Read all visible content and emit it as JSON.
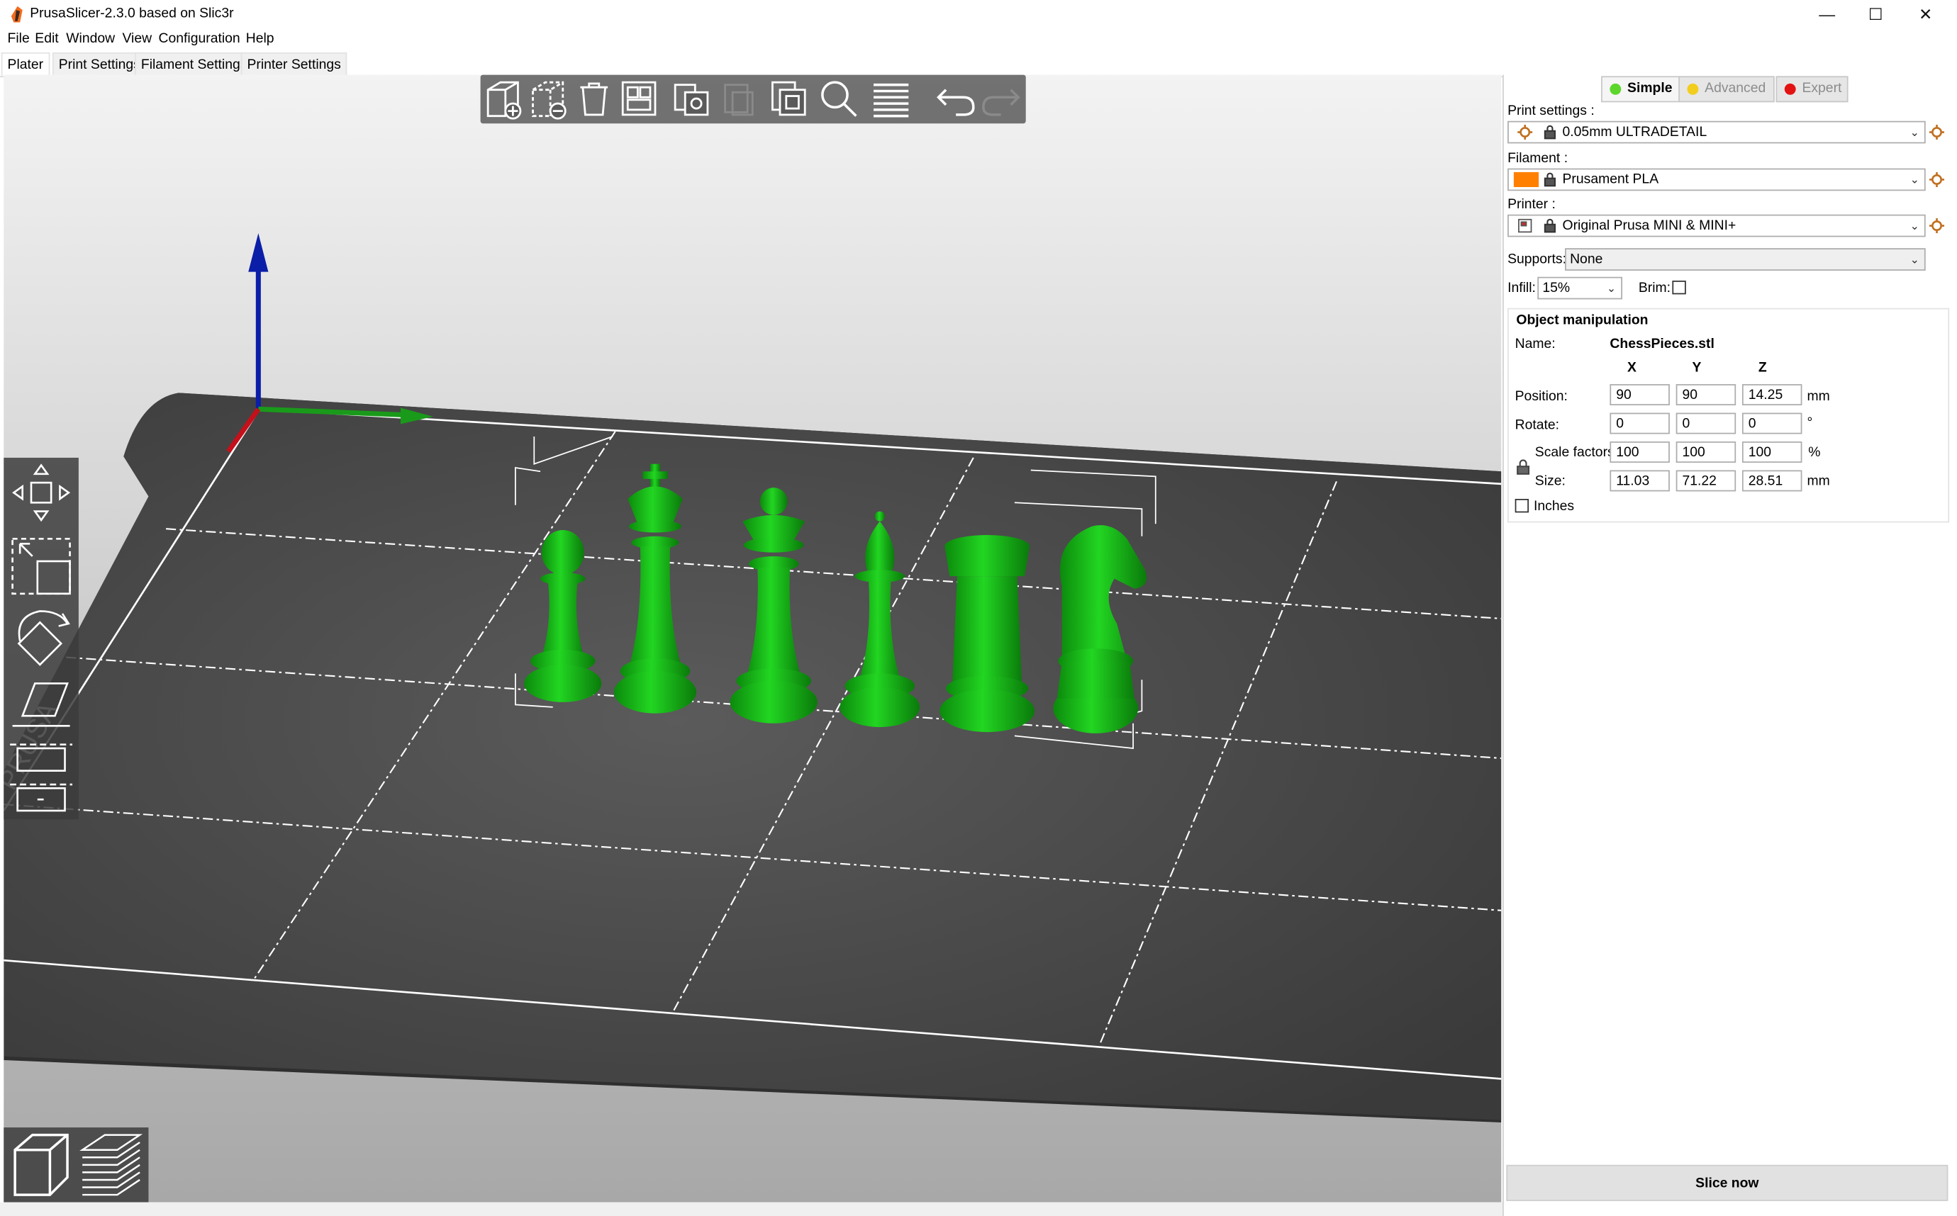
{
  "window": {
    "title": "PrusaSlicer-2.3.0 based on Slic3r",
    "minimize": "—",
    "maximize": "☐",
    "close": "✕"
  },
  "menu": [
    "File",
    "Edit",
    "Window",
    "View",
    "Configuration",
    "Help"
  ],
  "tabs": [
    "Plater",
    "Print Settings",
    "Filament Settings",
    "Printer Settings"
  ],
  "modes": [
    {
      "label": "Simple",
      "color": "#5cd62b"
    },
    {
      "label": "Advanced",
      "color": "#f2cd1e"
    },
    {
      "label": "Expert",
      "color": "#e31313"
    }
  ],
  "presets": {
    "print_label": "Print settings :",
    "print_value": "0.05mm ULTRADETAIL",
    "filament_label": "Filament :",
    "filament_value": "Prusament PLA",
    "filament_color": "#ff8000",
    "printer_label": "Printer :",
    "printer_value": "Original Prusa MINI & MINI+",
    "supports_label": "Supports:",
    "supports_value": "None",
    "infill_label": "Infill:",
    "infill_value": "15%",
    "brim_label": "Brim:"
  },
  "object": {
    "heading": "Object manipulation",
    "name_label": "Name:",
    "name_value": "ChessPieces.stl",
    "axes": [
      "X",
      "Y",
      "Z"
    ],
    "position_label": "Position:",
    "position": [
      "90",
      "90",
      "14.25"
    ],
    "position_unit": "mm",
    "rotate_label": "Rotate:",
    "rotate": [
      "0",
      "0",
      "0"
    ],
    "rotate_unit": "°",
    "scale_label": "Scale factors:",
    "scale": [
      "100",
      "100",
      "100"
    ],
    "scale_unit": "%",
    "size_label": "Size:",
    "size": [
      "11.03",
      "71.22",
      "28.51"
    ],
    "size_unit": "mm",
    "inches_label": "Inches"
  },
  "slice_button": "Slice now",
  "accent": {
    "pieces": "#16c416",
    "axis_z": "#0b1ea8",
    "axis_x": "#c4101b",
    "axis_y": "#1a9a1a"
  },
  "toolbar_icons": [
    "add-icon",
    "delete-icon",
    "delete-all-icon",
    "arrange-icon",
    "copy-icon",
    "paste-icon",
    "instance-icon",
    "search-icon",
    "layers-icon",
    "undo-icon",
    "redo-icon"
  ],
  "gizmo_icons": [
    "move-icon",
    "scale-icon",
    "rotate-icon",
    "place-on-face-icon",
    "cut-icon",
    "variable-layer-icon"
  ],
  "view_icons": [
    "3d-view-icon",
    "preview-icon"
  ]
}
